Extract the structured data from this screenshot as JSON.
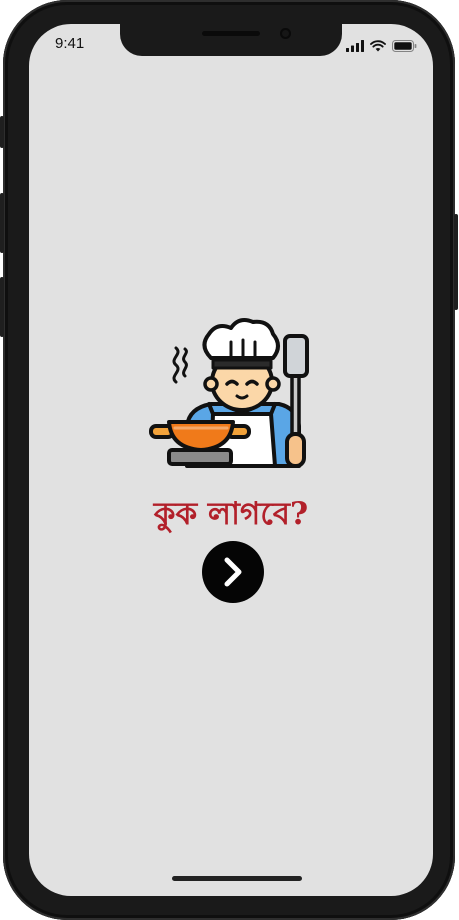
{
  "status_bar": {
    "time": "9:41",
    "icons": [
      "signal-icon",
      "wifi-icon",
      "battery-icon"
    ]
  },
  "main": {
    "illustration": "chef-cooking-icon",
    "title": "কুক লাগবে?",
    "next_button_icon": "chevron-right-icon"
  },
  "colors": {
    "background": "#e1e1e1",
    "title": "#b2202a",
    "button": "#050505"
  }
}
